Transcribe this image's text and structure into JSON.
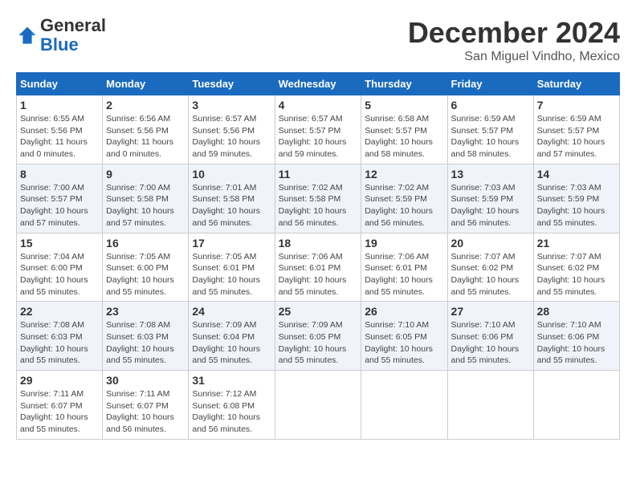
{
  "header": {
    "logo_general": "General",
    "logo_blue": "Blue",
    "month_title": "December 2024",
    "subtitle": "San Miguel Vindho, Mexico"
  },
  "days_of_week": [
    "Sunday",
    "Monday",
    "Tuesday",
    "Wednesday",
    "Thursday",
    "Friday",
    "Saturday"
  ],
  "weeks": [
    [
      {
        "day": "1",
        "info": "Sunrise: 6:55 AM\nSunset: 5:56 PM\nDaylight: 11 hours\nand 0 minutes."
      },
      {
        "day": "2",
        "info": "Sunrise: 6:56 AM\nSunset: 5:56 PM\nDaylight: 11 hours\nand 0 minutes."
      },
      {
        "day": "3",
        "info": "Sunrise: 6:57 AM\nSunset: 5:56 PM\nDaylight: 10 hours\nand 59 minutes."
      },
      {
        "day": "4",
        "info": "Sunrise: 6:57 AM\nSunset: 5:57 PM\nDaylight: 10 hours\nand 59 minutes."
      },
      {
        "day": "5",
        "info": "Sunrise: 6:58 AM\nSunset: 5:57 PM\nDaylight: 10 hours\nand 58 minutes."
      },
      {
        "day": "6",
        "info": "Sunrise: 6:59 AM\nSunset: 5:57 PM\nDaylight: 10 hours\nand 58 minutes."
      },
      {
        "day": "7",
        "info": "Sunrise: 6:59 AM\nSunset: 5:57 PM\nDaylight: 10 hours\nand 57 minutes."
      }
    ],
    [
      {
        "day": "8",
        "info": "Sunrise: 7:00 AM\nSunset: 5:57 PM\nDaylight: 10 hours\nand 57 minutes."
      },
      {
        "day": "9",
        "info": "Sunrise: 7:00 AM\nSunset: 5:58 PM\nDaylight: 10 hours\nand 57 minutes."
      },
      {
        "day": "10",
        "info": "Sunrise: 7:01 AM\nSunset: 5:58 PM\nDaylight: 10 hours\nand 56 minutes."
      },
      {
        "day": "11",
        "info": "Sunrise: 7:02 AM\nSunset: 5:58 PM\nDaylight: 10 hours\nand 56 minutes."
      },
      {
        "day": "12",
        "info": "Sunrise: 7:02 AM\nSunset: 5:59 PM\nDaylight: 10 hours\nand 56 minutes."
      },
      {
        "day": "13",
        "info": "Sunrise: 7:03 AM\nSunset: 5:59 PM\nDaylight: 10 hours\nand 56 minutes."
      },
      {
        "day": "14",
        "info": "Sunrise: 7:03 AM\nSunset: 5:59 PM\nDaylight: 10 hours\nand 55 minutes."
      }
    ],
    [
      {
        "day": "15",
        "info": "Sunrise: 7:04 AM\nSunset: 6:00 PM\nDaylight: 10 hours\nand 55 minutes."
      },
      {
        "day": "16",
        "info": "Sunrise: 7:05 AM\nSunset: 6:00 PM\nDaylight: 10 hours\nand 55 minutes."
      },
      {
        "day": "17",
        "info": "Sunrise: 7:05 AM\nSunset: 6:01 PM\nDaylight: 10 hours\nand 55 minutes."
      },
      {
        "day": "18",
        "info": "Sunrise: 7:06 AM\nSunset: 6:01 PM\nDaylight: 10 hours\nand 55 minutes."
      },
      {
        "day": "19",
        "info": "Sunrise: 7:06 AM\nSunset: 6:01 PM\nDaylight: 10 hours\nand 55 minutes."
      },
      {
        "day": "20",
        "info": "Sunrise: 7:07 AM\nSunset: 6:02 PM\nDaylight: 10 hours\nand 55 minutes."
      },
      {
        "day": "21",
        "info": "Sunrise: 7:07 AM\nSunset: 6:02 PM\nDaylight: 10 hours\nand 55 minutes."
      }
    ],
    [
      {
        "day": "22",
        "info": "Sunrise: 7:08 AM\nSunset: 6:03 PM\nDaylight: 10 hours\nand 55 minutes."
      },
      {
        "day": "23",
        "info": "Sunrise: 7:08 AM\nSunset: 6:03 PM\nDaylight: 10 hours\nand 55 minutes."
      },
      {
        "day": "24",
        "info": "Sunrise: 7:09 AM\nSunset: 6:04 PM\nDaylight: 10 hours\nand 55 minutes."
      },
      {
        "day": "25",
        "info": "Sunrise: 7:09 AM\nSunset: 6:05 PM\nDaylight: 10 hours\nand 55 minutes."
      },
      {
        "day": "26",
        "info": "Sunrise: 7:10 AM\nSunset: 6:05 PM\nDaylight: 10 hours\nand 55 minutes."
      },
      {
        "day": "27",
        "info": "Sunrise: 7:10 AM\nSunset: 6:06 PM\nDaylight: 10 hours\nand 55 minutes."
      },
      {
        "day": "28",
        "info": "Sunrise: 7:10 AM\nSunset: 6:06 PM\nDaylight: 10 hours\nand 55 minutes."
      }
    ],
    [
      {
        "day": "29",
        "info": "Sunrise: 7:11 AM\nSunset: 6:07 PM\nDaylight: 10 hours\nand 55 minutes."
      },
      {
        "day": "30",
        "info": "Sunrise: 7:11 AM\nSunset: 6:07 PM\nDaylight: 10 hours\nand 56 minutes."
      },
      {
        "day": "31",
        "info": "Sunrise: 7:12 AM\nSunset: 6:08 PM\nDaylight: 10 hours\nand 56 minutes."
      },
      null,
      null,
      null,
      null
    ]
  ]
}
